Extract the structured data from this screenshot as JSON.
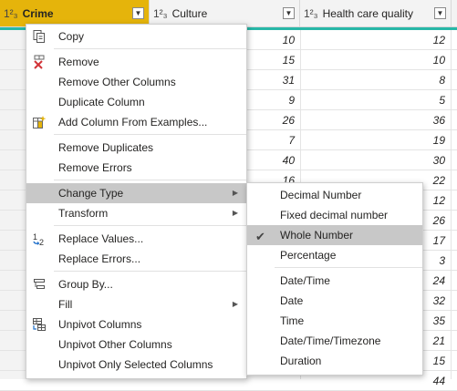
{
  "columns": [
    {
      "type_icon": "1²₃",
      "name": "Crime"
    },
    {
      "type_icon": "1²₃",
      "name": "Culture"
    },
    {
      "type_icon": "1²₃",
      "name": "Health care quality"
    }
  ],
  "culture_values": [
    "10",
    "15",
    "31",
    "9",
    "26",
    "7",
    "40",
    "16"
  ],
  "health_values": [
    "12",
    "10",
    "8",
    "5",
    "36",
    "19",
    "30",
    "22",
    "12",
    "26",
    "17",
    "3",
    "24",
    "32",
    "35",
    "21",
    "15",
    "44"
  ],
  "context_menu": {
    "items": [
      {
        "label": "Copy",
        "icon": "copy-icon"
      },
      {
        "label": "Remove",
        "icon": "remove-icon"
      },
      {
        "label": "Remove Other Columns"
      },
      {
        "label": "Duplicate Column"
      },
      {
        "label": "Add Column From Examples...",
        "icon": "add-column-examples-icon"
      },
      {
        "label": "Remove Duplicates"
      },
      {
        "label": "Remove Errors"
      },
      {
        "label": "Change Type",
        "submenu": true,
        "highlighted": true
      },
      {
        "label": "Transform",
        "submenu": true
      },
      {
        "label": "Replace Values...",
        "icon": "replace-values-icon"
      },
      {
        "label": "Replace Errors..."
      },
      {
        "label": "Group By...",
        "icon": "group-by-icon"
      },
      {
        "label": "Fill",
        "submenu": true
      },
      {
        "label": "Unpivot Columns",
        "icon": "unpivot-icon"
      },
      {
        "label": "Unpivot Other Columns"
      },
      {
        "label": "Unpivot Only Selected Columns"
      }
    ]
  },
  "type_submenu": {
    "items": [
      {
        "label": "Decimal Number"
      },
      {
        "label": "Fixed decimal number"
      },
      {
        "label": "Whole Number",
        "checked": true
      },
      {
        "label": "Percentage"
      },
      {
        "label": "Date/Time"
      },
      {
        "label": "Date"
      },
      {
        "label": "Time"
      },
      {
        "label": "Date/Time/Timezone"
      },
      {
        "label": "Duration"
      }
    ]
  }
}
